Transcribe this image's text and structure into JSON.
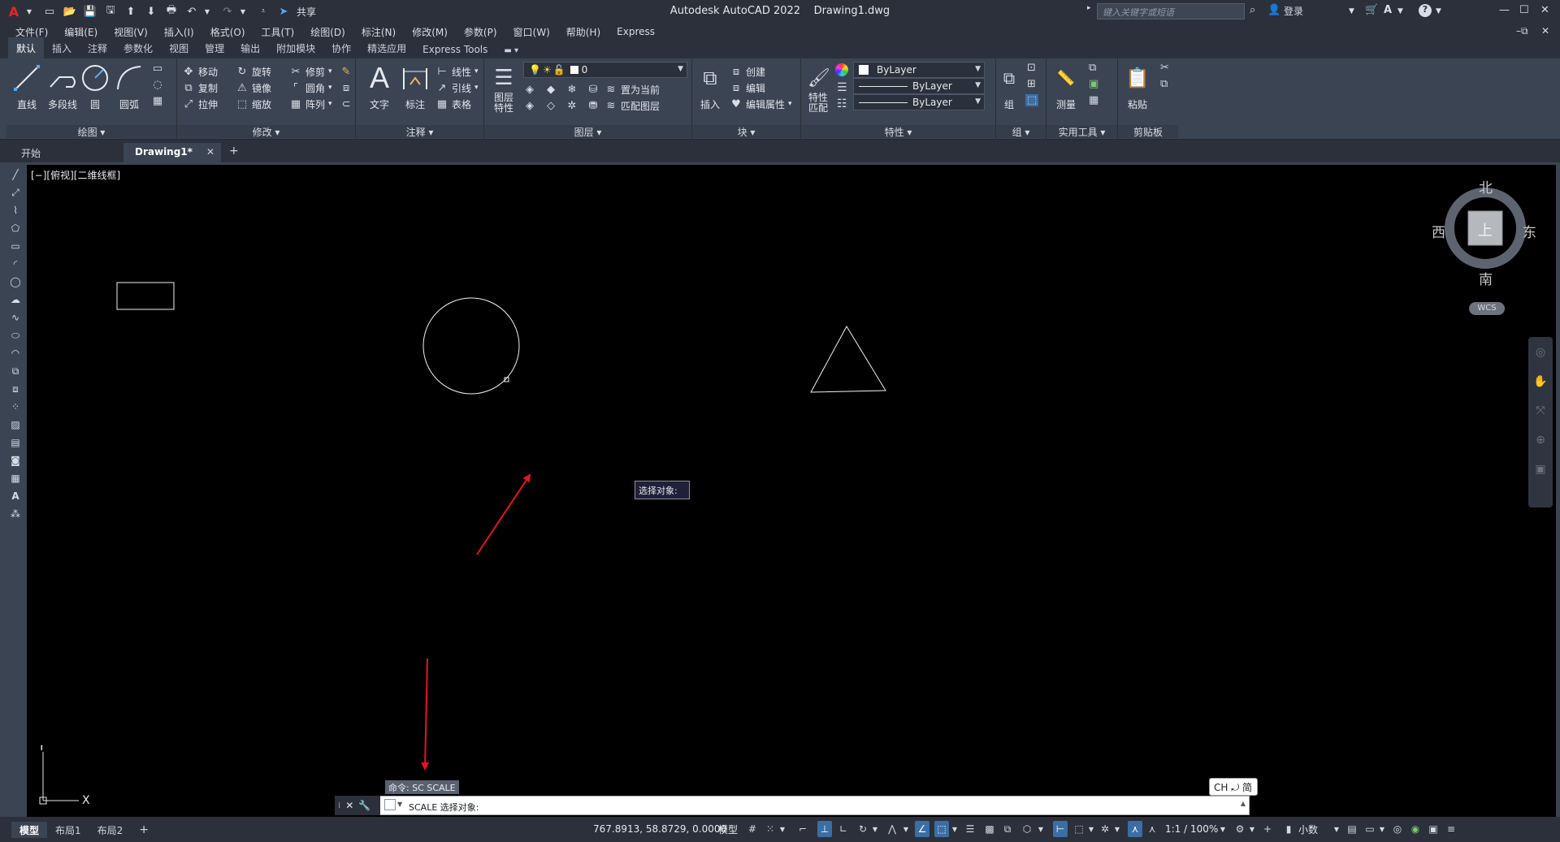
{
  "titlebar": {
    "app_title": "Autodesk AutoCAD 2022",
    "doc_title": "Drawing1.dwg",
    "share_label": "共享",
    "search_placeholder": "键入关键字或短语",
    "login_label": "登录"
  },
  "menubar": {
    "items": [
      "文件(F)",
      "编辑(E)",
      "视图(V)",
      "插入(I)",
      "格式(O)",
      "工具(T)",
      "绘图(D)",
      "标注(N)",
      "修改(M)",
      "参数(P)",
      "窗口(W)",
      "帮助(H)",
      "Express"
    ]
  },
  "ribbon_tabs": {
    "items": [
      "默认",
      "插入",
      "注释",
      "参数化",
      "视图",
      "管理",
      "输出",
      "附加模块",
      "协作",
      "精选应用",
      "Express Tools"
    ]
  },
  "ribbon": {
    "draw": {
      "title": "绘图",
      "line": "直线",
      "polyline": "多段线",
      "circle": "圆",
      "arc": "圆弧"
    },
    "modify": {
      "title": "修改",
      "move": "移动",
      "rotate": "旋转",
      "trim": "修剪",
      "copy": "复制",
      "mirror": "镜像",
      "fillet": "圆角",
      "stretch": "拉伸",
      "scale": "缩放",
      "array": "阵列"
    },
    "annotation": {
      "title": "注释",
      "text": "文字",
      "dimension": "标注",
      "linear": "线性",
      "leader": "引线",
      "table": "表格"
    },
    "layers": {
      "title": "图层",
      "layer_props": "图层\n特性",
      "current_layer": "0",
      "set_current": "置为当前",
      "match_layer": "匹配图层"
    },
    "block": {
      "title": "块",
      "insert": "插入",
      "create": "创建",
      "edit": "编辑",
      "edit_attr": "编辑属性"
    },
    "properties": {
      "title": "特性",
      "match": "特性\n匹配",
      "color": "ByLayer",
      "linetype": "ByLayer",
      "lineweight": "ByLayer"
    },
    "groups": {
      "title": "组",
      "group": "组"
    },
    "utilities": {
      "title": "实用工具",
      "measure": "测量"
    },
    "clipboard": {
      "title": "剪贴板",
      "paste": "粘贴"
    }
  },
  "filetabs": {
    "start": "开始",
    "drawing": "Drawing1*"
  },
  "viewport": {
    "label": "[−][俯视][二维线框]",
    "viewcube": {
      "north": "北",
      "south": "南",
      "east": "东",
      "west": "西",
      "face": "上",
      "wcs": "WCS"
    },
    "ucs": {
      "x": "X",
      "y": "Y"
    }
  },
  "tooltip": {
    "text": "选择对象:"
  },
  "command": {
    "history": "命令: SC SCALE",
    "prompt": "SCALE 选择对象:",
    "ime": "CH ⤾ 简"
  },
  "statusbar": {
    "tabs": [
      "模型",
      "布局1",
      "布局2"
    ],
    "coords": "767.8913, 58.8729, 0.0000",
    "model_label": "模型",
    "scale": "1:1 / 100%",
    "units": "小数"
  },
  "colors": {
    "canvas": "#000000",
    "ribbon": "#3b4453",
    "titlebar": "#2b303a",
    "arrow": "#e8141b",
    "accent": "#3a6ea5"
  }
}
